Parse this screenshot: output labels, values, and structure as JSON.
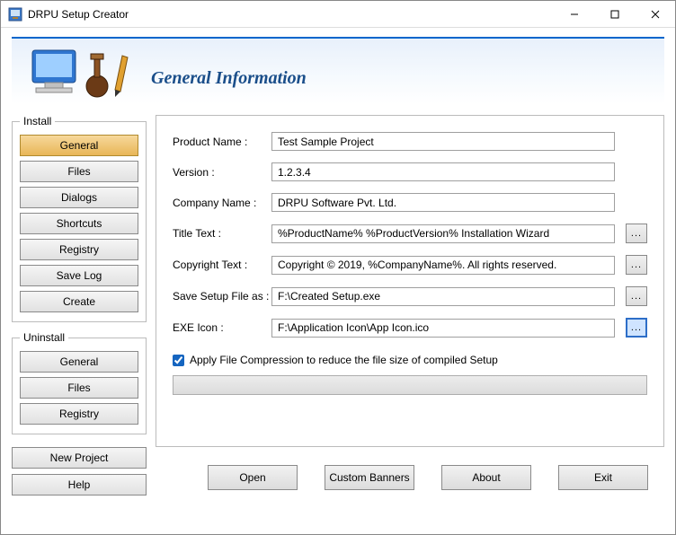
{
  "window": {
    "title": "DRPU Setup Creator",
    "heading": "General Information"
  },
  "sidebar": {
    "install": {
      "legend": "Install",
      "items": [
        "General",
        "Files",
        "Dialogs",
        "Shortcuts",
        "Registry",
        "Save Log",
        "Create"
      ]
    },
    "uninstall": {
      "legend": "Uninstall",
      "items": [
        "General",
        "Files",
        "Registry"
      ]
    },
    "bottom": [
      "New Project",
      "Help"
    ]
  },
  "form": {
    "productName": {
      "label": "Product Name :",
      "value": "Test Sample Project"
    },
    "version": {
      "label": "Version :",
      "value": "1.2.3.4"
    },
    "companyName": {
      "label": "Company Name :",
      "value": "DRPU Software Pvt. Ltd."
    },
    "titleText": {
      "label": "Title Text :",
      "value": "%ProductName% %ProductVersion% Installation Wizard",
      "browse": "..."
    },
    "copyright": {
      "label": "Copyright Text :",
      "value": "Copyright © 2019, %CompanyName%. All rights reserved.",
      "browse": "..."
    },
    "saveFile": {
      "label": "Save Setup File as :",
      "value": "F:\\Created Setup.exe",
      "browse": "..."
    },
    "exeIcon": {
      "label": "EXE Icon :",
      "value": "F:\\Application Icon\\App Icon.ico",
      "browse": "..."
    },
    "compressLabel": "Apply File Compression to reduce the file size of compiled Setup"
  },
  "footer": {
    "open": "Open",
    "banners": "Custom Banners",
    "about": "About",
    "exit": "Exit"
  }
}
